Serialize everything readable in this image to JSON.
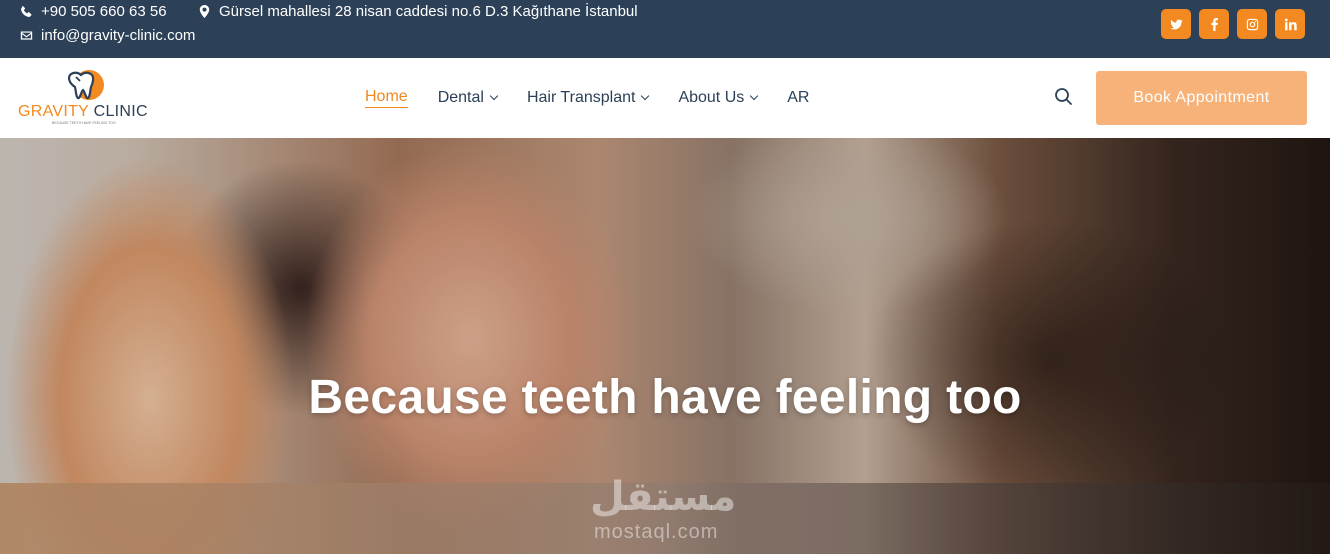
{
  "topbar": {
    "phone": "+90 505 660 63 56",
    "address": "Gürsel mahallesi 28 nisan caddesi no.6 D.3 Kağıthane İstanbul",
    "email": "info@gravity-clinic.com",
    "socials": [
      "twitter-icon",
      "facebook-icon",
      "instagram-icon",
      "linkedin-icon"
    ],
    "accent": "#f28a21",
    "background": "#2c4057"
  },
  "header": {
    "logo": {
      "brand_primary": "GRAVITY",
      "brand_secondary": "CLINIC",
      "tagline": "BECAUSE TEETH HAVE FEELING TOO"
    },
    "nav": [
      {
        "label": "Home",
        "active": true,
        "dropdown": false
      },
      {
        "label": "Dental",
        "active": false,
        "dropdown": true
      },
      {
        "label": "Hair Transplant",
        "active": false,
        "dropdown": true
      },
      {
        "label": "About Us",
        "active": false,
        "dropdown": true
      },
      {
        "label": "AR",
        "active": false,
        "dropdown": false
      }
    ],
    "book_button": "Book Appointment",
    "book_button_color": "#f6b279"
  },
  "hero": {
    "title": "Because teeth have feeling too",
    "watermark_ar": "مستقل",
    "watermark_en": "mostaql.com"
  }
}
